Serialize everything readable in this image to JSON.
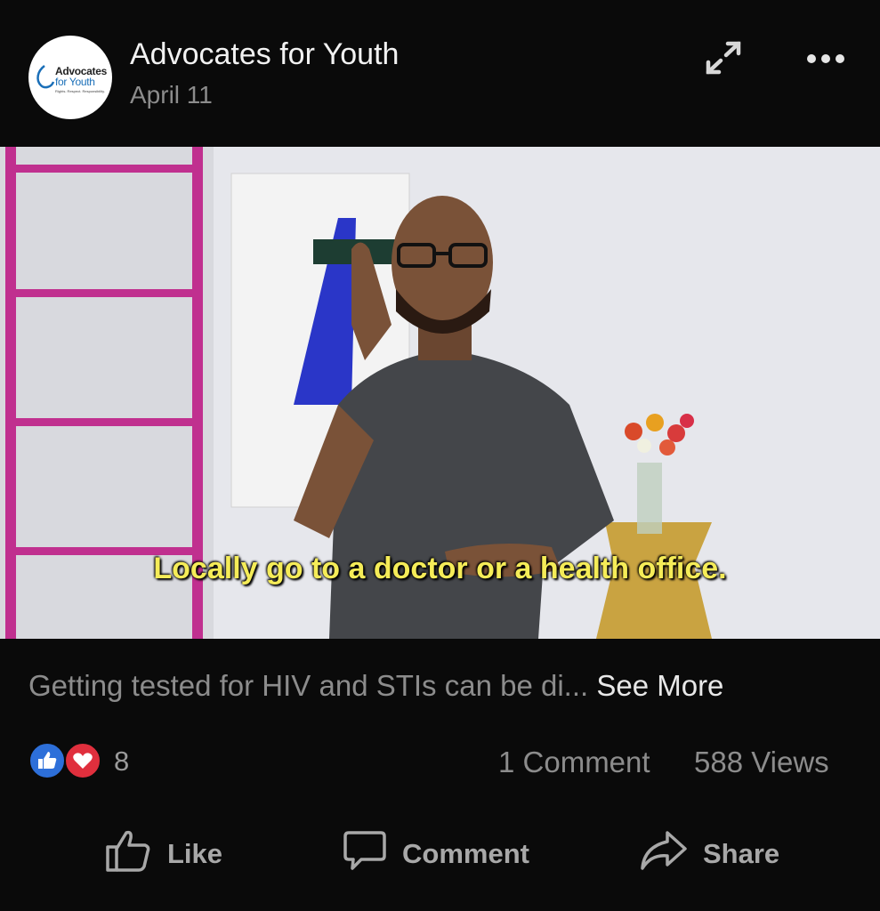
{
  "post": {
    "page_name": "Advocates for Youth",
    "date": "April 11",
    "avatar_logo": {
      "line1": "Advocates",
      "line2": "for Youth",
      "tagline": "Rights. Respect. Responsibility."
    },
    "header_icons": {
      "expand": "expand-icon",
      "more": "more-options-icon"
    }
  },
  "video": {
    "caption": "Locally go to a doctor or a health office."
  },
  "description": {
    "text": "Getting tested for HIV and STIs can be di...",
    "see_more": "See More"
  },
  "stats": {
    "reaction_count": "8",
    "reaction_icons": [
      "like-reaction-icon",
      "love-reaction-icon"
    ],
    "comments": "1 Comment",
    "views": "588 Views"
  },
  "actions": {
    "like": "Like",
    "comment": "Comment",
    "share": "Share"
  },
  "colors": {
    "background": "#0a0a0a",
    "caption": "#f5ec58",
    "like_blue": "#2d6fd9",
    "love_red": "#e02f3d",
    "muted_text": "#8c8c8c"
  }
}
